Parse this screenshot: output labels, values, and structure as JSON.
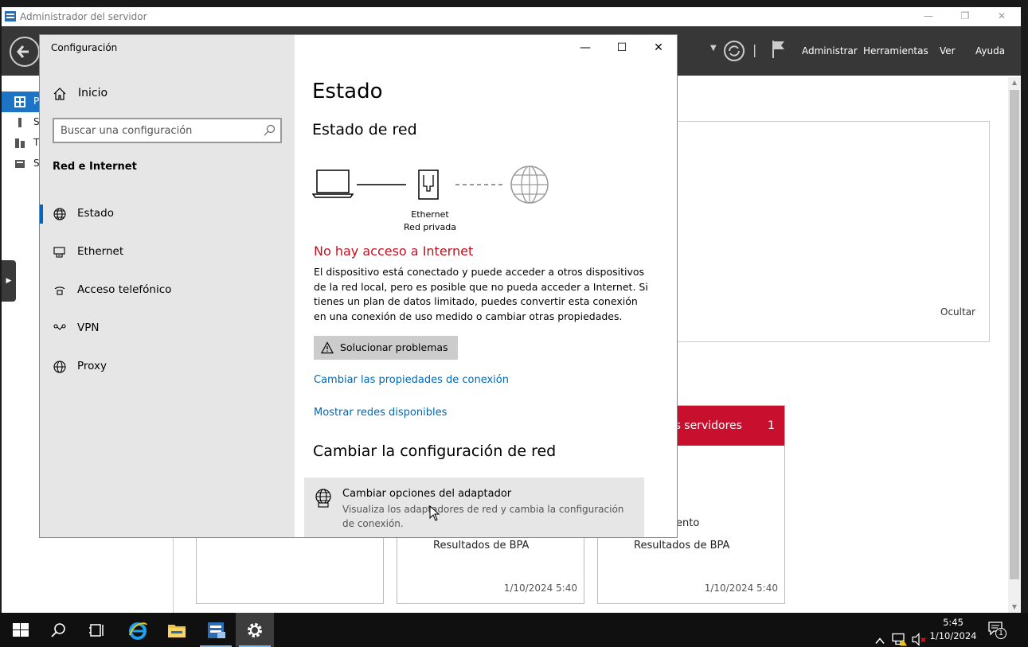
{
  "server_manager": {
    "title": "Administrador del servidor",
    "menu": [
      "Administrar",
      "Herramientas",
      "Ver",
      "Ayuda"
    ],
    "nav_letters": [
      "P",
      "S",
      "T",
      "S"
    ],
    "ocultar": "Ocultar",
    "tiles": [
      {
        "header": "os servidores",
        "count": "1",
        "line1": "ento",
        "line2": "Resultados de BPA",
        "time": "1/10/2024 5:40"
      },
      {
        "line2": "Resultados de BPA",
        "time": "1/10/2024 5:40"
      }
    ]
  },
  "settings": {
    "window_title": "Configuración",
    "home_label": "Inicio",
    "search_placeholder": "Buscar una configuración",
    "section": "Red e Internet",
    "nav": [
      {
        "label": "Estado",
        "icon": "globe-icon"
      },
      {
        "label": "Ethernet",
        "icon": "ethernet-icon"
      },
      {
        "label": "Acceso telefónico",
        "icon": "dialup-icon"
      },
      {
        "label": "VPN",
        "icon": "vpn-icon"
      },
      {
        "label": "Proxy",
        "icon": "globe-icon"
      }
    ],
    "page_title": "Estado",
    "network_status_heading": "Estado de red",
    "adapter_name": "Ethernet",
    "network_type": "Red privada",
    "no_internet": "No hay acceso a Internet",
    "description": "El dispositivo está conectado y puede acceder a otros dispositivos de la red local, pero es posible que no pueda acceder a Internet. Si tienes un plan de datos limitado, puedes convertir esta conexión en una conexión de uso medido o cambiar otras propiedades.",
    "troubleshoot_button": "Solucionar problemas",
    "link_change_properties": "Cambiar las propiedades de conexión",
    "link_show_networks": "Mostrar redes disponibles",
    "change_settings_heading": "Cambiar la configuración de red",
    "adapter_card_title": "Cambiar opciones del adaptador",
    "adapter_card_desc": "Visualiza los adaptadores de red y cambia la configuración de conexión."
  },
  "taskbar": {
    "time": "5:45",
    "date": "1/10/2024",
    "notification_count": "1"
  },
  "colors": {
    "accent": "#0067c0",
    "error": "#c50f1f",
    "link": "#0066b4",
    "tile_header": "#c8102e",
    "sm_nav_active": "#1e74c4"
  }
}
